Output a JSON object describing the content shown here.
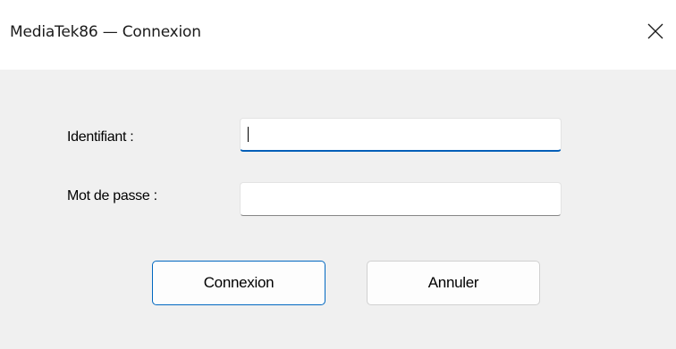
{
  "window": {
    "title": "MediaTek86 — Connexion",
    "close_icon": "close-icon"
  },
  "form": {
    "username_label": "Identifiant :",
    "username_value": "",
    "password_label": "Mot de passe :",
    "password_value": ""
  },
  "buttons": {
    "login_label": "Connexion",
    "cancel_label": "Annuler"
  },
  "colors": {
    "accent": "#005fb8",
    "dialog_background": "#f0f0f0",
    "titlebar_background": "#ffffff"
  }
}
